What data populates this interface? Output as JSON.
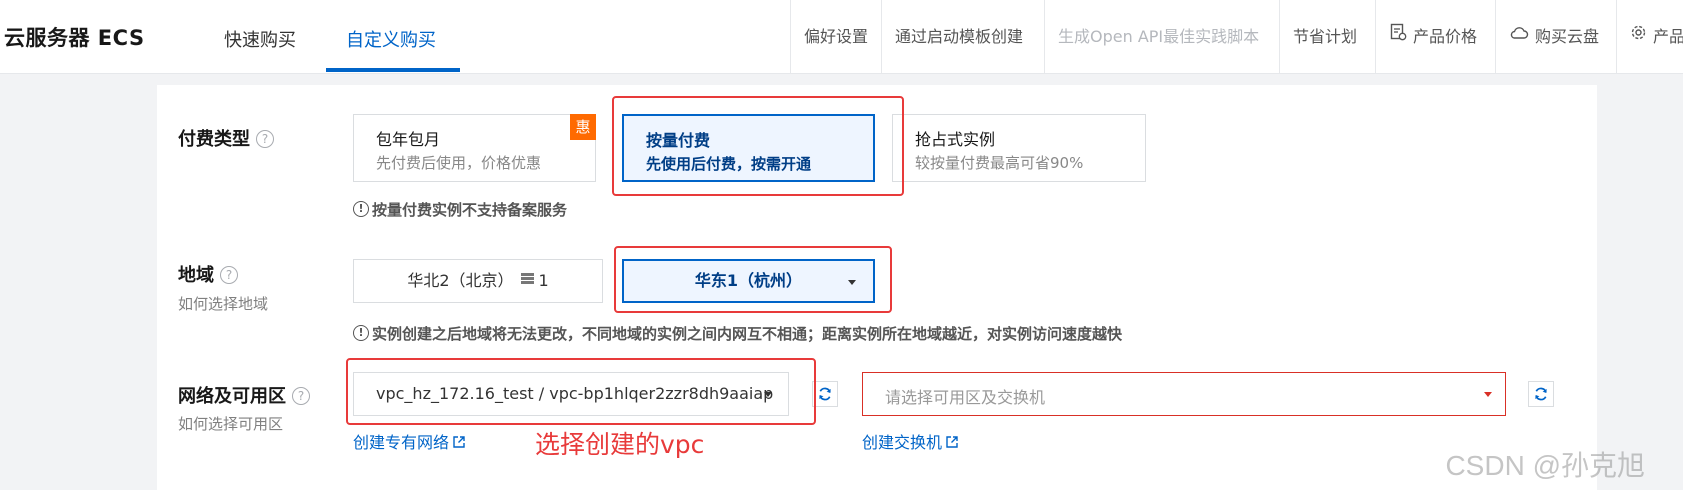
{
  "header": {
    "app_title": "云服务器 ECS",
    "tabs": [
      {
        "label": "快速购买",
        "active": false
      },
      {
        "label": "自定义购买",
        "active": true
      }
    ],
    "toolbar": [
      {
        "label": "偏好设置",
        "icon": "",
        "disabled": false
      },
      {
        "label": "通过启动模板创建",
        "icon": "",
        "disabled": false
      },
      {
        "label": "生成Open API最佳实践脚本",
        "icon": "",
        "disabled": true
      },
      {
        "label": "节省计划",
        "icon": "",
        "disabled": false
      },
      {
        "label": "产品价格",
        "icon": "price-doc-icon",
        "disabled": false
      },
      {
        "label": "购买云盘",
        "icon": "cloud-icon",
        "disabled": false
      },
      {
        "label": "产品",
        "icon": "gear-icon",
        "disabled": false
      }
    ]
  },
  "billing": {
    "label": "付费类型",
    "options": [
      {
        "title": "包年包月",
        "desc": "先付费后使用，价格优惠",
        "badge": "惠",
        "selected": false
      },
      {
        "title": "按量付费",
        "desc": "先使用后付费，按需开通",
        "badge": "",
        "selected": true
      },
      {
        "title": "抢占式实例",
        "desc": "较按量付费最高可省90%",
        "badge": "",
        "selected": false
      }
    ],
    "hint": "按量付费实例不支持备案服务"
  },
  "region": {
    "label": "地域",
    "sublabel": "如何选择地域",
    "options": [
      {
        "label": "华北2（北京）",
        "count": "1",
        "selected": false
      },
      {
        "label": "华东1（杭州）",
        "selected": true
      }
    ],
    "hint": "实例创建之后地域将无法更改，不同地域的实例之间内网互不相通；距离实例所在地域越近，对实例访问速度越快"
  },
  "network": {
    "label": "网络及可用区",
    "sublabel": "如何选择可用区",
    "vpc_value": "vpc_hz_172.16_test / vpc-bp1hlqer2zzr8dh9aaiap",
    "zone_placeholder": "请选择可用区及交换机",
    "create_vpc_link": "创建专有网络",
    "create_switch_link": "创建交换机"
  },
  "annotation": {
    "text": "选择创建的vpc",
    "color": "#e83a3a"
  },
  "watermark": "CSDN @孙克旭",
  "colors": {
    "primary": "#0064c8",
    "selected_bg": "#eef5ff",
    "badge": "#ff6a00",
    "error": "#d93026"
  }
}
